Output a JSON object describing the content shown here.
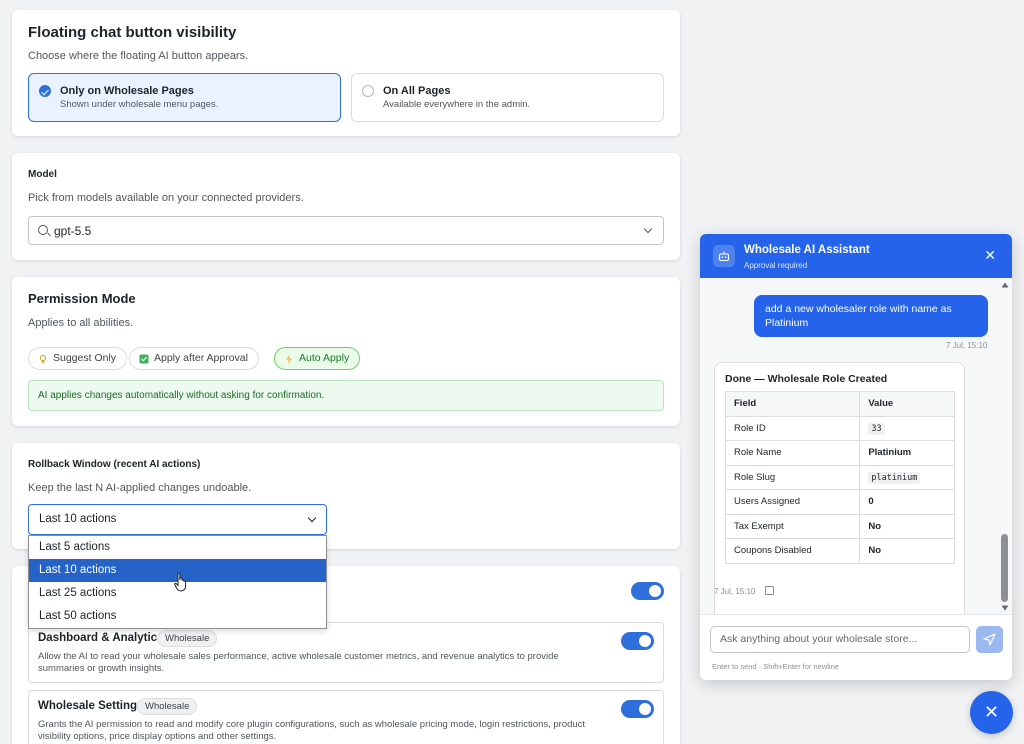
{
  "visibility": {
    "title": "Floating chat button visibility",
    "description": "Choose where the floating AI button appears.",
    "options": [
      {
        "title": "Only on Wholesale Pages",
        "desc": "Shown under wholesale menu pages.",
        "selected": true
      },
      {
        "title": "On All Pages",
        "desc": "Available everywhere in the admin.",
        "selected": false
      }
    ]
  },
  "model": {
    "title": "Model",
    "description": "Pick from models available on your connected providers.",
    "value": "gpt-5.5"
  },
  "permission": {
    "title": "Permission Mode",
    "description": "Applies to all abilities.",
    "modes": [
      "Suggest Only",
      "Apply after Approval",
      "Auto Apply"
    ],
    "active_mode": "Auto Apply",
    "notice": "AI applies changes automatically without asking for confirmation."
  },
  "rollback": {
    "title": "Rollback Window (recent AI actions)",
    "description": "Keep the last N AI-applied changes undoable.",
    "value": "Last 10 actions",
    "options": [
      "Last 5 actions",
      "Last 10 actions",
      "Last 25 actions",
      "Last 50 actions"
    ],
    "highlighted": "Last 10 actions"
  },
  "abilities": [
    {
      "title": "Dashboard & Analytics",
      "badge": "Wholesale",
      "desc": "Allow the AI to read your wholesale sales performance, active wholesale customer metrics, and revenue analytics to provide summaries or growth insights.",
      "enabled": true
    },
    {
      "title": "Wholesale Settings",
      "badge": "Wholesale",
      "desc": "Grants the AI permission to read and modify core plugin configurations, such as wholesale pricing mode, login restrictions, product visibility options, price display options and other settings.",
      "enabled": true
    }
  ],
  "chat": {
    "title": "Wholesale AI Assistant",
    "subtitle": "Approval required",
    "user_message": "add a new wholesaler role with name as Platinium",
    "user_time": "7 Jul, 15:10",
    "result_title": "Done — Wholesale Role Created",
    "table_headers": [
      "Field",
      "Value"
    ],
    "table_rows": [
      {
        "field": "Role ID",
        "value": "33"
      },
      {
        "field": "Role Name",
        "value": "Platinium"
      },
      {
        "field": "Role Slug",
        "value": "platinium"
      },
      {
        "field": "Users Assigned",
        "value": "0"
      },
      {
        "field": "Tax Exempt",
        "value": "No"
      },
      {
        "field": "Coupons Disabled",
        "value": "No"
      }
    ],
    "bot_time": "7 Jul, 15:10",
    "input_placeholder": "Ask anything about your wholesale store...",
    "hint": "Enter to send · Shift+Enter for newline"
  },
  "colors": {
    "accent": "#2563eb",
    "success": "#1d7a2d"
  }
}
